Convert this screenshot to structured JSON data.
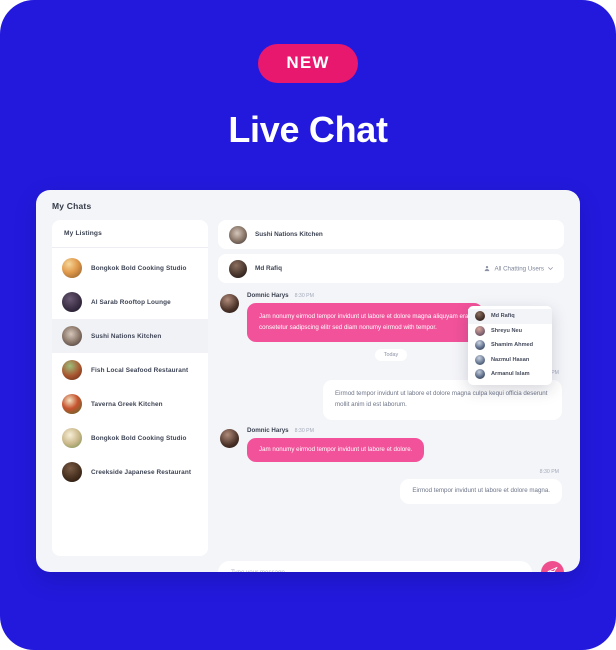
{
  "hero": {
    "badge": "NEW",
    "title": "Live Chat",
    "badge_color": "#E8186E",
    "background_color": "#2219DD"
  },
  "card": {
    "title": "My Chats"
  },
  "sidebar": {
    "header": "My Listings",
    "items": [
      {
        "label": "Bongkok Bold Cooking Studio",
        "active": false
      },
      {
        "label": "Al Sarab Rooftop Lounge",
        "active": false
      },
      {
        "label": "Sushi Nations Kitchen",
        "active": true
      },
      {
        "label": "Fish Local Seafood Restaurant",
        "active": false
      },
      {
        "label": "Taverna Greek Kitchen",
        "active": false
      },
      {
        "label": "Bongkok Bold Cooking Studio",
        "active": false
      },
      {
        "label": "Creekside Japanese Restaurant",
        "active": false
      }
    ]
  },
  "chat": {
    "listing_name": "Sushi Nations Kitchen",
    "active_user": "Md Rafiq",
    "users_toggle_label": "All Chatting Users",
    "dropdown_users": [
      {
        "name": "Md Rafiq",
        "highlighted": true
      },
      {
        "name": "Shreyu Neu",
        "highlighted": false
      },
      {
        "name": "Shamim Ahmed",
        "highlighted": false
      },
      {
        "name": "Nazmul Hasan",
        "highlighted": false
      },
      {
        "name": "Armanul Islam",
        "highlighted": false
      }
    ],
    "date_divider": "Today",
    "messages": [
      {
        "side": "left",
        "sender": "Domnic Harys",
        "time": "8:30 PM",
        "text": "Jam nonumy eirmod tempor invidunt ut labore et dolore magna aliquyam erat consetetur sadipscing elitr sed diam nonumy eirmod with tempor."
      },
      {
        "side": "right",
        "time": "8:30 PM",
        "text": "Eirmod tempor invidunt ut labore et dolore magna culpa kequi officia deserunt mollit anim id est laborum."
      },
      {
        "side": "left",
        "sender": "Domnic Harys",
        "time": "8:30 PM",
        "text": "Jam nonumy eirmod tempor invidunt ut labore et dolore."
      },
      {
        "side": "right",
        "time": "8:30 PM",
        "text": "Eirmod tempor invidunt ut labore et dolore magna."
      }
    ],
    "composer": {
      "placeholder": "Type your message...",
      "value": "",
      "send_label": "send-icon",
      "send_color": "#EE4E8E"
    },
    "bubble_colors": {
      "outgoing": "#F2529A",
      "incoming": "#FFFFFF"
    }
  }
}
